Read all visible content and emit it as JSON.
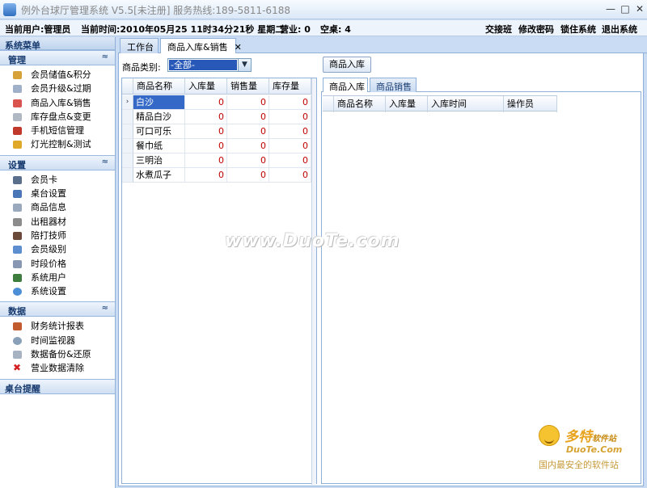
{
  "window": {
    "title": "例外台球厅管理系统 V5.5[未注册] 服务热线:189-5811-6188",
    "minimize_glyph": "—",
    "maximize_glyph": "□",
    "close_glyph": "✕"
  },
  "infobar": {
    "user": "当前用户:管理员",
    "time": "当前时间:2010年05月25 11时34分21秒 星期二",
    "in_business": "营业: 0",
    "idle_tables": "空桌: 4",
    "actions": [
      "交接班",
      "修改密码",
      "锁住系统",
      "退出系统"
    ]
  },
  "sidebar": {
    "title": "系统菜单",
    "sections": [
      {
        "title": "管理",
        "items": [
          "会员储值&积分",
          "会员升级&过期",
          "商品入库&销售",
          "库存盘点&变更",
          "手机短信管理",
          "灯光控制&测试"
        ]
      },
      {
        "title": "设置",
        "items": [
          "会员卡",
          "桌台设置",
          "商品信息",
          "出租器材",
          "陪打技师",
          "会员级别",
          "时段价格",
          "系统用户",
          "系统设置"
        ]
      },
      {
        "title": "数据",
        "items": [
          "财务统计报表",
          "时间监视器",
          "数据备份&还原",
          "营业数据清除"
        ]
      }
    ],
    "tray_title": "桌台提醒",
    "collapse_glyph": "≈"
  },
  "tabs": {
    "items": [
      "工作台",
      "商品入库&销售"
    ],
    "close_glyph": "✕"
  },
  "filter": {
    "label": "商品类别:",
    "selected": "-全部-",
    "arrow": "▼",
    "stock_in_button": "商品入库"
  },
  "left_grid": {
    "columns": [
      "商品名称",
      "入库量",
      "销售量",
      "库存量"
    ],
    "rows": [
      [
        "白沙",
        "0",
        "0",
        "0"
      ],
      [
        "精品白沙",
        "0",
        "0",
        "0"
      ],
      [
        "可口可乐",
        "0",
        "0",
        "0"
      ],
      [
        "餐巾纸",
        "0",
        "0",
        "0"
      ],
      [
        "三明治",
        "0",
        "0",
        "0"
      ],
      [
        "水煮瓜子",
        "0",
        "0",
        "0"
      ]
    ],
    "row_pointer": "›"
  },
  "right_panel": {
    "tabs": [
      "商品入库",
      "商品销售"
    ],
    "columns": [
      "商品名称",
      "入库量",
      "入库时间",
      "操作员"
    ]
  },
  "watermark": {
    "main": "www.DuoTe.com",
    "brand": "多特",
    "brand_small": "软件站",
    "url": "DuoTe.Com",
    "tagline": "国内最安全的软件站"
  },
  "colors": {
    "accent": "#3469c7",
    "number_red": "#c00000",
    "frame": "#8fb0d8"
  }
}
